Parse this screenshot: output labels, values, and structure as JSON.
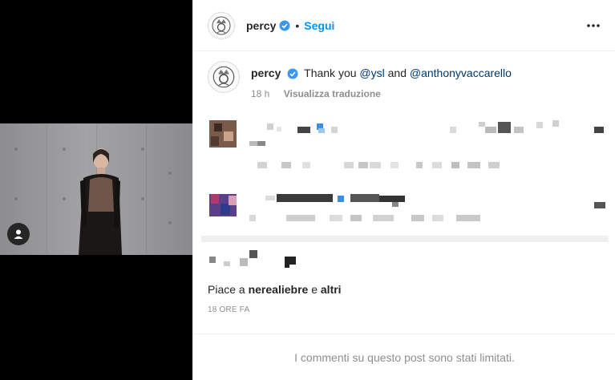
{
  "post": {
    "author": "percy",
    "follow_label": "Segui",
    "separator": "•"
  },
  "caption": {
    "username": "percy",
    "text_before": "Thank you ",
    "mention1": "@ysl",
    "text_middle": " and ",
    "mention2": "@anthonyvaccarello",
    "age": "18 h",
    "translate_label": "Visualizza traduzione"
  },
  "likes": {
    "prefix": "Piace a ",
    "user": "nerealiebre",
    "middle": " e ",
    "others": "altri"
  },
  "timestamp": "18 ORE FA",
  "comments_limited": "I commenti su questo post sono stati limitati.",
  "colors": {
    "link_blue": "#0095f6",
    "mention": "#00376b",
    "muted": "#8e8e8e",
    "verified_blue": "#3897f0"
  },
  "icons": {
    "verified": "verified-badge-icon",
    "more": "more-options-icon",
    "user_tag": "user-tag-icon"
  }
}
